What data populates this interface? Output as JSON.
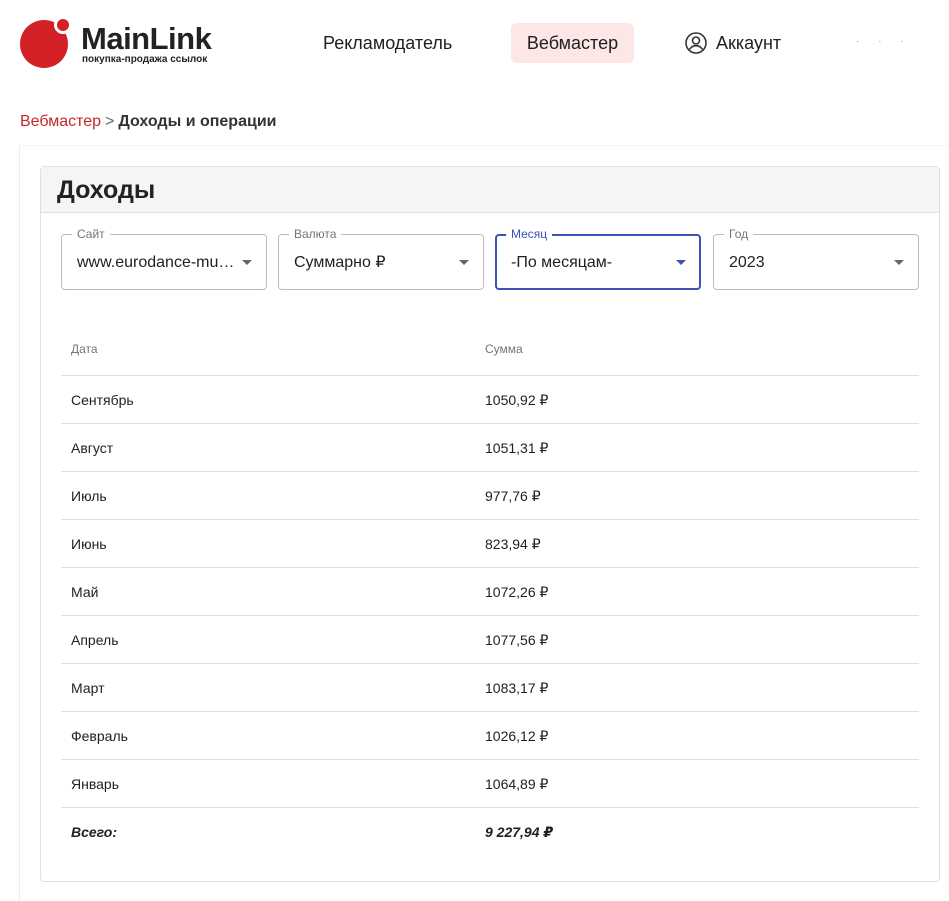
{
  "logo": {
    "name": "MainLink",
    "tagline": "покупка-продажа ссылок"
  },
  "nav": {
    "advertiser": "Рекламодатель",
    "webmaster": "Вебмастер",
    "account": "Аккаунт"
  },
  "breadcrumb": {
    "parent": "Вебмастер",
    "separator": ">",
    "current": "Доходы и операции"
  },
  "card": {
    "title": "Доходы"
  },
  "filters": {
    "site": {
      "label": "Сайт",
      "value": "www.eurodance-music.ru"
    },
    "currency": {
      "label": "Валюта",
      "value": "Суммарно ₽"
    },
    "month": {
      "label": "Месяц",
      "value": "-По месяцам-"
    },
    "year": {
      "label": "Год",
      "value": "2023"
    }
  },
  "table": {
    "headers": {
      "date": "Дата",
      "amount": "Сумма"
    },
    "rows": [
      {
        "date": "Сентябрь",
        "amount": "1050,92 ₽"
      },
      {
        "date": "Август",
        "amount": "1051,31 ₽"
      },
      {
        "date": "Июль",
        "amount": "977,76 ₽"
      },
      {
        "date": "Июнь",
        "amount": "823,94 ₽"
      },
      {
        "date": "Май",
        "amount": "1072,26 ₽"
      },
      {
        "date": "Апрель",
        "amount": "1077,56 ₽"
      },
      {
        "date": "Март",
        "amount": "1083,17 ₽"
      },
      {
        "date": "Февраль",
        "amount": "1026,12 ₽"
      },
      {
        "date": "Январь",
        "amount": "1064,89 ₽"
      }
    ],
    "total": {
      "label": "Всего:",
      "amount": "9 227,94 ₽"
    }
  },
  "colors": {
    "brand": "#d32027",
    "nav_active_bg": "#fde6e6",
    "focus": "#3f51b5"
  }
}
